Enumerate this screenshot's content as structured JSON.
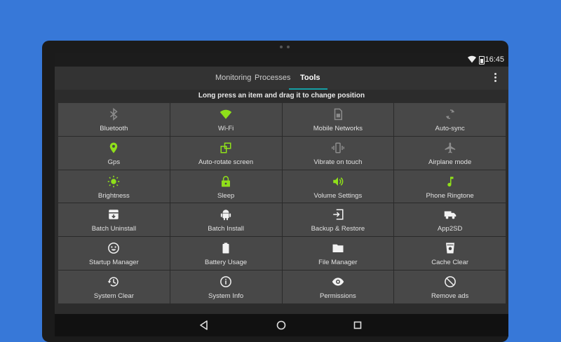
{
  "status_bar": {
    "time": "16:45"
  },
  "tabs": [
    {
      "label": "Monitoring"
    },
    {
      "label": "Processes"
    },
    {
      "label": "Tools"
    }
  ],
  "hint": "Long press an item and drag it to change position",
  "colors": {
    "accent_green": "#8fe01a",
    "grey_icon": "#8c8c8c",
    "white_icon": "#f2f2f2",
    "tab_indicator": "#16a0a6"
  },
  "tools": [
    {
      "label": "Bluetooth",
      "icon": "bluetooth-icon",
      "color": "grey"
    },
    {
      "label": "Wi-Fi",
      "icon": "wifi-icon",
      "color": "green"
    },
    {
      "label": "Mobile Networks",
      "icon": "sim-card-icon",
      "color": "grey"
    },
    {
      "label": "Auto-sync",
      "icon": "sync-icon",
      "color": "grey"
    },
    {
      "label": "Gps",
      "icon": "location-pin-icon",
      "color": "green"
    },
    {
      "label": "Auto-rotate screen",
      "icon": "rotate-screen-icon",
      "color": "green"
    },
    {
      "label": "Vibrate on touch",
      "icon": "vibrate-icon",
      "color": "grey"
    },
    {
      "label": "Airplane mode",
      "icon": "airplane-icon",
      "color": "grey"
    },
    {
      "label": "Brightness",
      "icon": "brightness-icon",
      "color": "green"
    },
    {
      "label": "Sleep",
      "icon": "lock-icon",
      "color": "green"
    },
    {
      "label": "Volume Settings",
      "icon": "volume-icon",
      "color": "green"
    },
    {
      "label": "Phone Ringtone",
      "icon": "music-note-icon",
      "color": "green"
    },
    {
      "label": "Batch Uninstall",
      "icon": "uninstall-box-icon",
      "color": "white"
    },
    {
      "label": "Batch Install",
      "icon": "android-icon",
      "color": "white"
    },
    {
      "label": "Backup & Restore",
      "icon": "backup-restore-icon",
      "color": "white"
    },
    {
      "label": "App2SD",
      "icon": "truck-icon",
      "color": "white"
    },
    {
      "label": "Startup Manager",
      "icon": "smiley-icon",
      "color": "white"
    },
    {
      "label": "Battery Usage",
      "icon": "battery-icon",
      "color": "white"
    },
    {
      "label": "File Manager",
      "icon": "folder-icon",
      "color": "white"
    },
    {
      "label": "Cache Clear",
      "icon": "cache-cup-icon",
      "color": "white"
    },
    {
      "label": "System Clear",
      "icon": "history-icon",
      "color": "white"
    },
    {
      "label": "System Info",
      "icon": "info-icon",
      "color": "white"
    },
    {
      "label": "Permissions",
      "icon": "eye-icon",
      "color": "white"
    },
    {
      "label": "Remove ads",
      "icon": "block-icon",
      "color": "white"
    }
  ]
}
